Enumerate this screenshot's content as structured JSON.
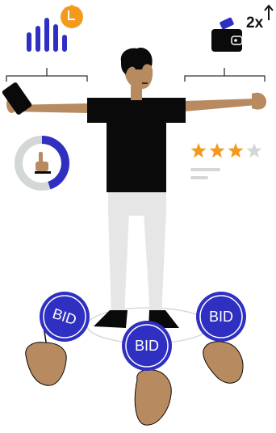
{
  "top_right": {
    "multiplier": "2x"
  },
  "rating": {
    "filled_stars": 3,
    "total_stars": 4
  },
  "donut": {
    "progress_fraction": 0.45
  },
  "paddles": [
    {
      "label": "BID"
    },
    {
      "label": "BID"
    },
    {
      "label": "BID"
    }
  ],
  "colors": {
    "accent_blue": "#2F2FC2",
    "orange": "#F39A1E",
    "star_empty": "#D3D7D6",
    "skin": "#B78A5F",
    "shirt": "#0A0A0A",
    "pants": "#E6E6E6",
    "line_gray": "#BFC4C2"
  }
}
